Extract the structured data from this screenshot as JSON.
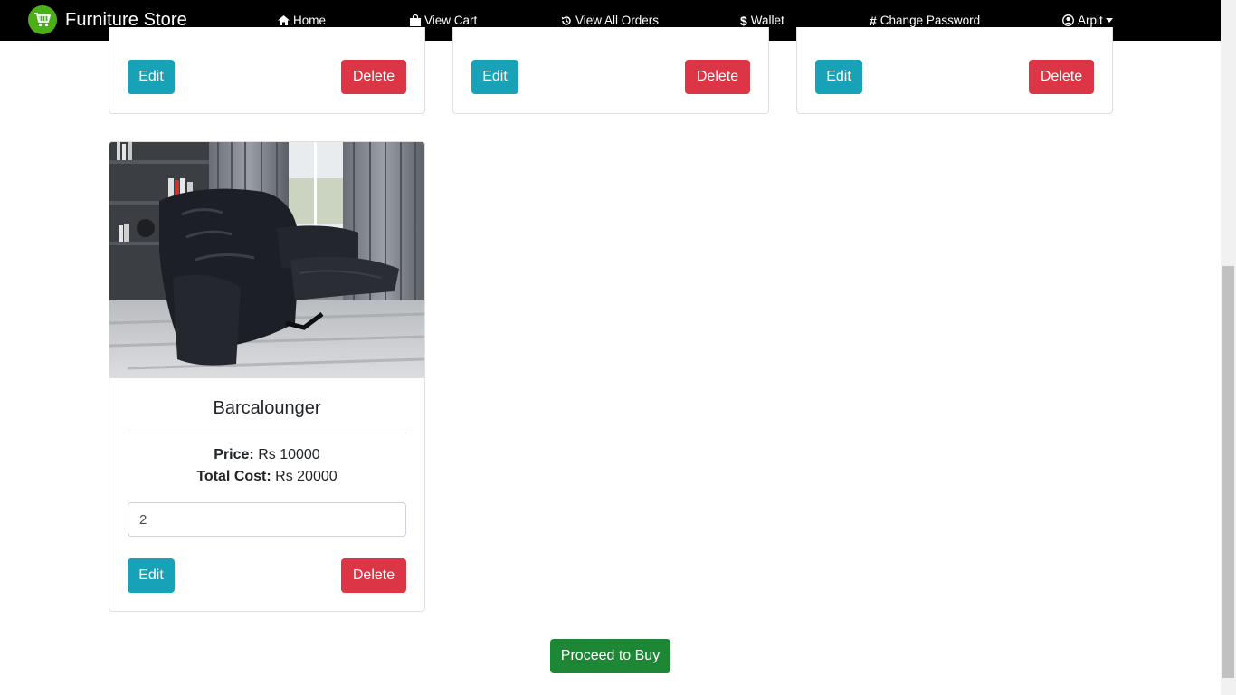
{
  "navbar": {
    "brand": "Furniture Store",
    "items": [
      {
        "label": "Home",
        "icon": "home-icon"
      },
      {
        "label": "View Cart",
        "icon": "shopping-bag-icon"
      },
      {
        "label": "View All Orders",
        "icon": "history-icon"
      },
      {
        "label": "Wallet",
        "icon": "dollar-icon"
      },
      {
        "label": "Change Password",
        "icon": "hashtag-icon"
      },
      {
        "label": "Arpit",
        "icon": "user-circle-icon"
      }
    ]
  },
  "top_cards": [
    {
      "edit_label": "Edit",
      "delete_label": "Delete"
    },
    {
      "edit_label": "Edit",
      "delete_label": "Delete"
    },
    {
      "edit_label": "Edit",
      "delete_label": "Delete"
    }
  ],
  "product_card": {
    "name": "Barcalounger",
    "price_label": "Price:",
    "price_value": "Rs 10000",
    "total_label": "Total Cost:",
    "total_value": "Rs 20000",
    "quantity": "2",
    "edit_label": "Edit",
    "delete_label": "Delete"
  },
  "proceed_label": "Proceed to Buy",
  "colors": {
    "navbar": "#000000",
    "edit": "#17a2b8",
    "delete": "#dc3545",
    "proceed": "#1e8735",
    "brand_logo": "#4caf1a"
  }
}
